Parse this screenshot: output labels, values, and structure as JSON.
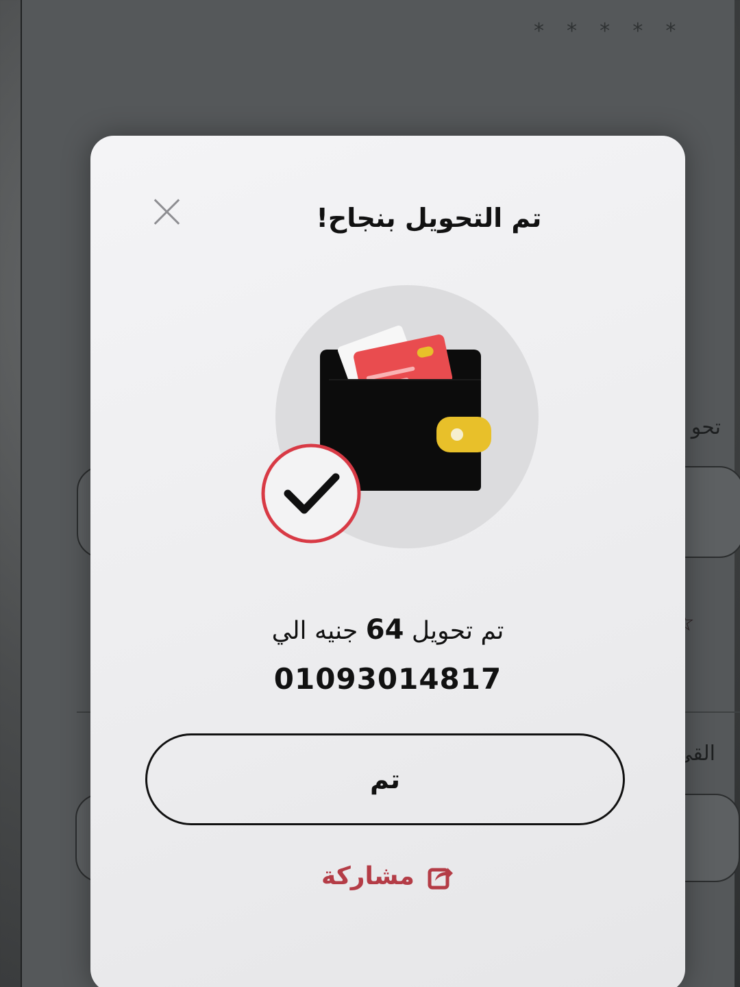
{
  "background": {
    "masked_value": "* * * * *",
    "label_one": "تحو",
    "label_two": "القي"
  },
  "modal": {
    "title": "تم التحويل بنجاح!",
    "message_prefix": "تم تحويل",
    "amount": "64",
    "message_suffix": "جنيه الي",
    "phone_number": "01093014817",
    "done_button_label": "تم",
    "share_label": "مشاركة",
    "icons": {
      "close": "close-icon",
      "illustration": "wallet-icon",
      "success": "checkmark-icon",
      "share": "share-icon"
    }
  },
  "colors": {
    "accent": "#b43c46",
    "check_ring": "#d83a45",
    "card_red": "#e94c4f",
    "clasp_yellow": "#e8c02a",
    "wallet_black": "#0c0c0c"
  }
}
